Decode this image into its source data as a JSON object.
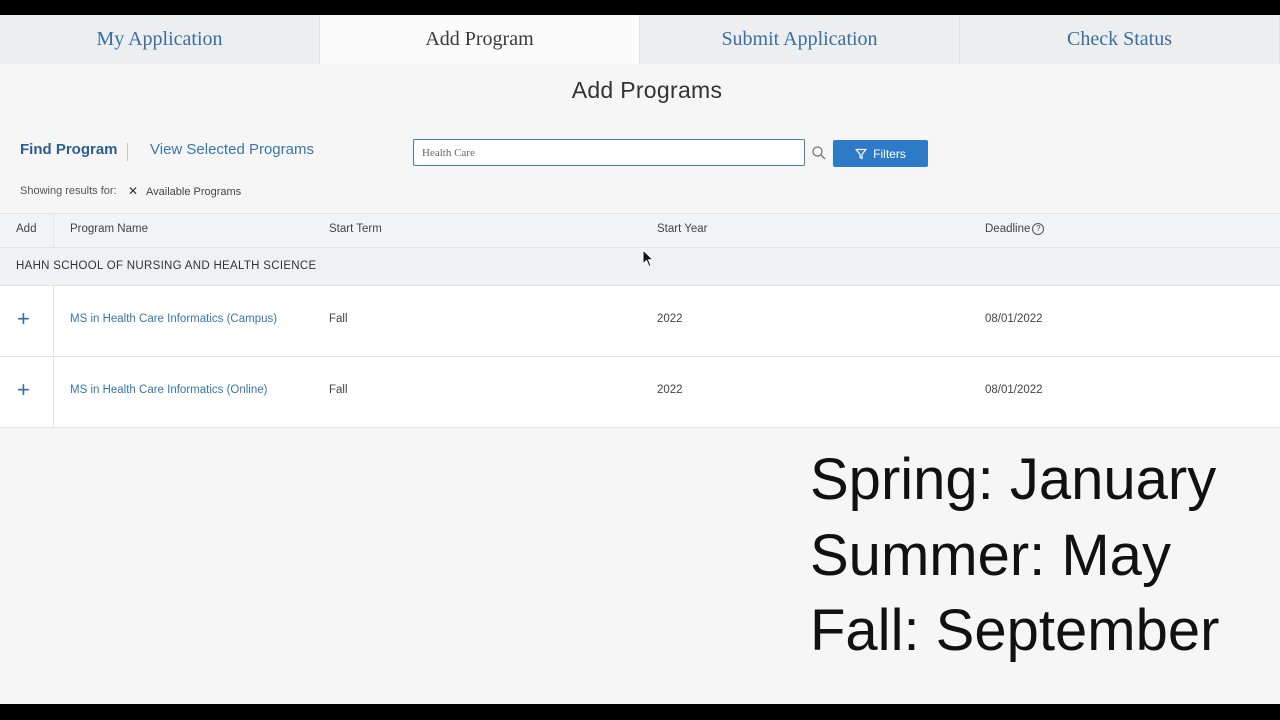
{
  "tabs": [
    {
      "label": "My Application",
      "active": false
    },
    {
      "label": "Add Program",
      "active": true
    },
    {
      "label": "Submit Application",
      "active": false
    },
    {
      "label": "Check Status",
      "active": false
    }
  ],
  "page_title": "Add Programs",
  "nav": {
    "find_program": "Find Program",
    "view_selected": "View Selected Programs"
  },
  "search": {
    "value": "Health Care"
  },
  "filters_label": "Filters",
  "showing": {
    "label": "Showing results for:",
    "chip": "Available Programs"
  },
  "table": {
    "headers": {
      "add": "Add",
      "program": "Program Name",
      "term": "Start Term",
      "year": "Start Year",
      "deadline": "Deadline"
    },
    "group": "HAHN SCHOOL OF NURSING AND HEALTH SCIENCE",
    "rows": [
      {
        "program": "MS in Health Care Informatics (Campus)",
        "term": "Fall",
        "year": "2022",
        "deadline": "08/01/2022"
      },
      {
        "program": "MS in Health Care Informatics (Online)",
        "term": "Fall",
        "year": "2022",
        "deadline": "08/01/2022"
      }
    ]
  },
  "overlay": [
    "Spring: January",
    "Summer: May",
    "Fall: September"
  ],
  "colors": {
    "accent": "#2f7ac8",
    "link": "#3a75b0"
  }
}
